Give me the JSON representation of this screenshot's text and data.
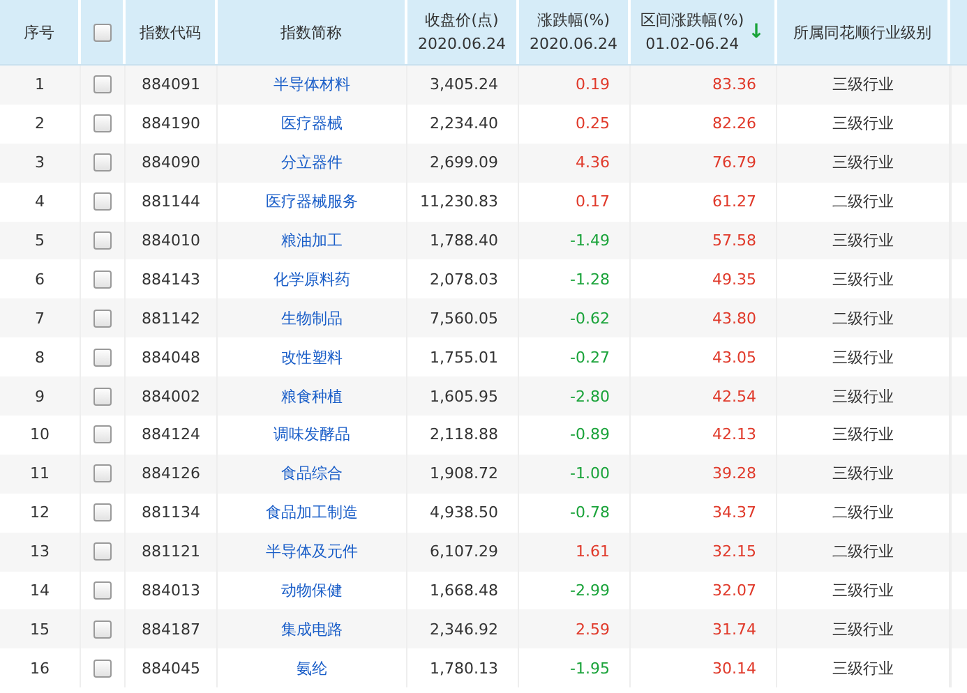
{
  "table": {
    "columns": [
      {
        "label": "序号"
      },
      {
        "kind": "checkbox",
        "checked": false
      },
      {
        "label": "指数代码"
      },
      {
        "label": "指数简称"
      },
      {
        "label": "收盘价(点)",
        "sub": "2020.06.24"
      },
      {
        "label": "涨跌幅(%)",
        "sub": "2020.06.24"
      },
      {
        "label": "区间涨跌幅(%)",
        "sub": "01.02-06.24",
        "sort": "↓"
      },
      {
        "label": "所属同花顺行业级别"
      }
    ],
    "rows": [
      {
        "no": "1",
        "checked": false,
        "code": "884091",
        "name": "半导体材料",
        "close": "3,405.24",
        "change": "0.19",
        "color": "#e0392a",
        "range": "83.36",
        "level": "三级行业"
      },
      {
        "no": "2",
        "checked": false,
        "code": "884190",
        "name": "医疗器械",
        "close": "2,234.40",
        "change": "0.25",
        "color": "#e0392a",
        "range": "82.26",
        "level": "三级行业"
      },
      {
        "no": "3",
        "checked": false,
        "code": "884090",
        "name": "分立器件",
        "close": "2,699.09",
        "change": "4.36",
        "color": "#e0392a",
        "range": "76.79",
        "level": "三级行业"
      },
      {
        "no": "4",
        "checked": false,
        "code": "881144",
        "name": "医疗器械服务",
        "close": "11,230.83",
        "change": "0.17",
        "color": "#e0392a",
        "range": "61.27",
        "level": "二级行业"
      },
      {
        "no": "5",
        "checked": false,
        "code": "884010",
        "name": "粮油加工",
        "close": "1,788.40",
        "change": "-1.49",
        "color": "#1aa33a",
        "range": "57.58",
        "level": "三级行业"
      },
      {
        "no": "6",
        "checked": false,
        "code": "884143",
        "name": "化学原料药",
        "close": "2,078.03",
        "change": "-1.28",
        "color": "#1aa33a",
        "range": "49.35",
        "level": "三级行业"
      },
      {
        "no": "7",
        "checked": false,
        "code": "881142",
        "name": "生物制品",
        "close": "7,560.05",
        "change": "-0.62",
        "color": "#1aa33a",
        "range": "43.80",
        "level": "二级行业"
      },
      {
        "no": "8",
        "checked": false,
        "code": "884048",
        "name": "改性塑料",
        "close": "1,755.01",
        "change": "-0.27",
        "color": "#1aa33a",
        "range": "43.05",
        "level": "三级行业"
      },
      {
        "no": "9",
        "checked": false,
        "code": "884002",
        "name": "粮食种植",
        "close": "1,605.95",
        "change": "-2.80",
        "color": "#1aa33a",
        "range": "42.54",
        "level": "三级行业"
      },
      {
        "no": "10",
        "checked": false,
        "code": "884124",
        "name": "调味发酵品",
        "close": "2,118.88",
        "change": "-0.89",
        "color": "#1aa33a",
        "range": "42.13",
        "level": "三级行业"
      },
      {
        "no": "11",
        "checked": false,
        "code": "884126",
        "name": "食品综合",
        "close": "1,908.72",
        "change": "-1.00",
        "color": "#1aa33a",
        "range": "39.28",
        "level": "三级行业"
      },
      {
        "no": "12",
        "checked": false,
        "code": "881134",
        "name": "食品加工制造",
        "close": "4,938.50",
        "change": "-0.78",
        "color": "#1aa33a",
        "range": "34.37",
        "level": "二级行业"
      },
      {
        "no": "13",
        "checked": false,
        "code": "881121",
        "name": "半导体及元件",
        "close": "6,107.29",
        "change": "1.61",
        "color": "#e0392a",
        "range": "32.15",
        "level": "二级行业"
      },
      {
        "no": "14",
        "checked": false,
        "code": "884013",
        "name": "动物保健",
        "close": "1,668.48",
        "change": "-2.99",
        "color": "#1aa33a",
        "range": "32.07",
        "level": "三级行业"
      },
      {
        "no": "15",
        "checked": false,
        "code": "884187",
        "name": "集成电路",
        "close": "2,346.92",
        "change": "2.59",
        "color": "#e0392a",
        "range": "31.74",
        "level": "三级行业"
      },
      {
        "no": "16",
        "checked": false,
        "code": "884045",
        "name": "氨纶",
        "close": "1,780.13",
        "change": "-1.95",
        "color": "#1aa33a",
        "range": "30.14",
        "level": "三级行业"
      }
    ]
  }
}
